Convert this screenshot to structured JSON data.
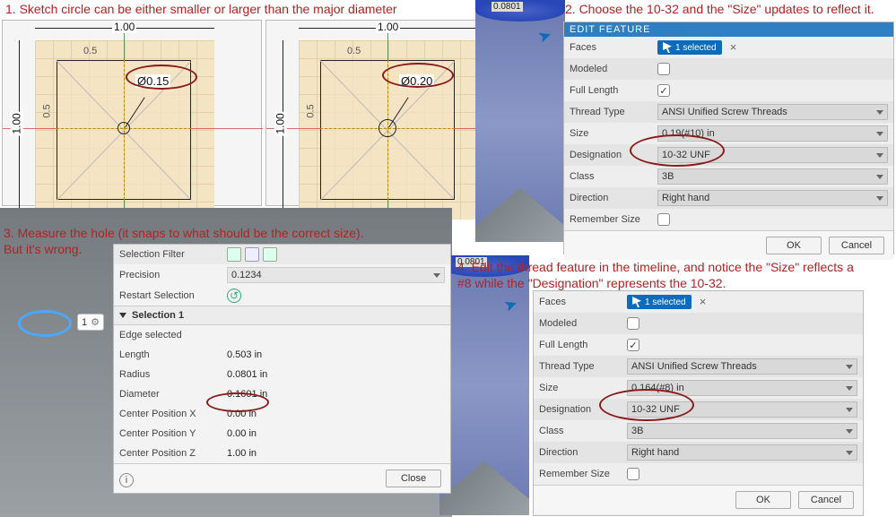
{
  "annotations": {
    "a1": "1. Sketch circle can be either smaller or larger than the major diameter",
    "a2": "2. Choose the 10-32 and the \"Size\" updates to reflect it.",
    "a3_line1": "3. Measure the hole (it snaps to what should be the correct size).",
    "a3_line2": "But it's wrong.",
    "a4_line1": "4. Edit the thread feature in the timeline, and notice the \"Size\" reflects a",
    "a4_line2": "#8 while the \"Designation\" represents the 10-32."
  },
  "sketch": {
    "outer_dim": "1.00",
    "inner_dim": "0.5",
    "dia1": "Ø0.15",
    "dia2": "Ø0.20"
  },
  "cylinder": {
    "top_dim": "0.0801"
  },
  "edit_feature": {
    "title": "EDIT FEATURE",
    "labels": {
      "faces": "Faces",
      "modeled": "Modeled",
      "full_length": "Full Length",
      "thread_type": "Thread Type",
      "size": "Size",
      "designation": "Designation",
      "class": "Class",
      "direction": "Direction",
      "remember": "Remember Size"
    },
    "faces_badge": "1 selected",
    "thread_type": "ANSI Unified Screw Threads",
    "size_1": "0.19(#10) in",
    "size_2": "0.164(#8) in",
    "designation": "10-32 UNF",
    "class": "3B",
    "direction": "Right hand",
    "btn_ok": "OK",
    "btn_cancel": "Cancel"
  },
  "measure": {
    "labels": {
      "sel_filter": "Selection Filter",
      "precision": "Precision",
      "restart": "Restart Selection",
      "section": "Selection 1",
      "edge": "Edge selected",
      "length": "Length",
      "radius": "Radius",
      "diameter": "Diameter",
      "cpx": "Center Position X",
      "cpy": "Center Position Y",
      "cpz": "Center Position Z"
    },
    "precision": "0.1234",
    "length": "0.503 in",
    "radius": "0.0801 in",
    "diameter": "0.1601 in",
    "cpx": "0.00 in",
    "cpy": "0.00 in",
    "cpz": "1.00 in",
    "btn_close": "Close",
    "sel_badge": "1"
  }
}
